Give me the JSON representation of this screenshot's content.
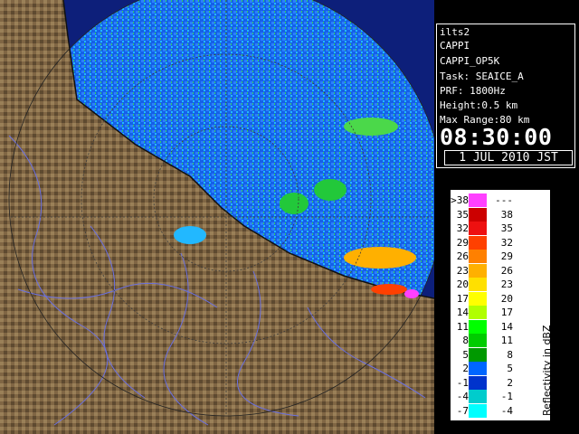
{
  "info": {
    "site": "ilts2",
    "product": "CAPPI",
    "product_name": "CAPPI_OP5K",
    "task": "Task: SEAICE_A",
    "prf": "PRF: 1800Hz",
    "height": "Height:0.5 km",
    "max_range": "Max Range:80 km",
    "time": "08:30:00",
    "date": "1 JUL 2010 JST"
  },
  "legend": {
    "unit": "Reflectivity in dBZ",
    "rows": [
      {
        "left": ">38",
        "right": "---",
        "color": "#ff40ff"
      },
      {
        "left": "35",
        "right": "38",
        "color": "#cc0000"
      },
      {
        "left": "32",
        "right": "35",
        "color": "#ee1010"
      },
      {
        "left": "29",
        "right": "32",
        "color": "#ff4000"
      },
      {
        "left": "26",
        "right": "29",
        "color": "#ff8000"
      },
      {
        "left": "23",
        "right": "26",
        "color": "#ffb000"
      },
      {
        "left": "20",
        "right": "23",
        "color": "#ffe000"
      },
      {
        "left": "17",
        "right": "20",
        "color": "#ffff00"
      },
      {
        "left": "14",
        "right": "17",
        "color": "#b0ff00"
      },
      {
        "left": "11",
        "right": "14",
        "color": "#00ff00"
      },
      {
        "left": "8",
        "right": "11",
        "color": "#00cc00"
      },
      {
        "left": "5",
        "right": "8",
        "color": "#009900"
      },
      {
        "left": "2",
        "right": "5",
        "color": "#0066ff"
      },
      {
        "left": "-1",
        "right": "2",
        "color": "#0033cc"
      },
      {
        "left": "-4",
        "right": "-1",
        "color": "#00cccc"
      },
      {
        "left": "-7",
        "right": "-4",
        "color": "#00ffff"
      }
    ]
  },
  "colors": {
    "sea": "#0d1f7a",
    "land": "#8a7048",
    "echo_blue": "#1a6cff",
    "echo_green": "#22c83a"
  }
}
